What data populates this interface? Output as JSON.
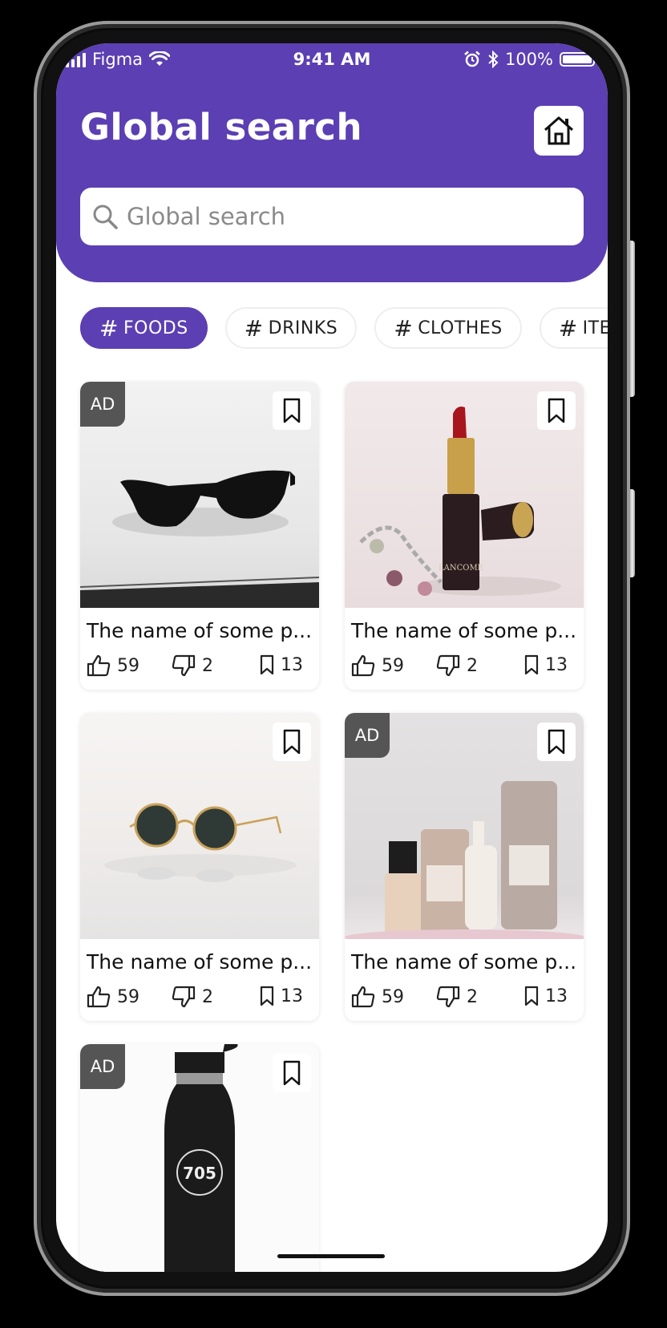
{
  "status_bar": {
    "carrier": "Figma",
    "time": "9:41 AM",
    "battery_percent": "100%",
    "icons": [
      "signal-icon",
      "wifi-icon",
      "alarm-icon",
      "bluetooth-icon",
      "battery-icon"
    ]
  },
  "header": {
    "title": "Global search",
    "home_icon": "home-icon"
  },
  "search": {
    "placeholder": "Global search",
    "value": ""
  },
  "categories": [
    {
      "hash": "#",
      "label": "FOODS",
      "active": true
    },
    {
      "hash": "#",
      "label": "DRINKS",
      "active": false
    },
    {
      "hash": "#",
      "label": "CLOTHES",
      "active": false
    },
    {
      "hash": "#",
      "label": "ITEMS",
      "active": false
    }
  ],
  "products": [
    {
      "ad_label": "AD",
      "name": "The name of some p...",
      "likes": "59",
      "dislikes": "2",
      "saves": "13",
      "image": "sunglasses-black"
    },
    {
      "ad_label": "",
      "name": "The name of some p...",
      "likes": "59",
      "dislikes": "2",
      "saves": "13",
      "image": "lipstick"
    },
    {
      "ad_label": "",
      "name": "The name of some p...",
      "likes": "59",
      "dislikes": "2",
      "saves": "13",
      "image": "sunglasses-round"
    },
    {
      "ad_label": "AD",
      "name": "The name of some p...",
      "likes": "59",
      "dislikes": "2",
      "saves": "13",
      "image": "skincare-bottles"
    },
    {
      "ad_label": "AD",
      "name": "",
      "likes": "",
      "dislikes": "",
      "saves": "",
      "image": "water-bottle",
      "bottle_text": "705"
    }
  ],
  "colors": {
    "accent": "#5b3fb3",
    "ad_badge": "#555555"
  }
}
